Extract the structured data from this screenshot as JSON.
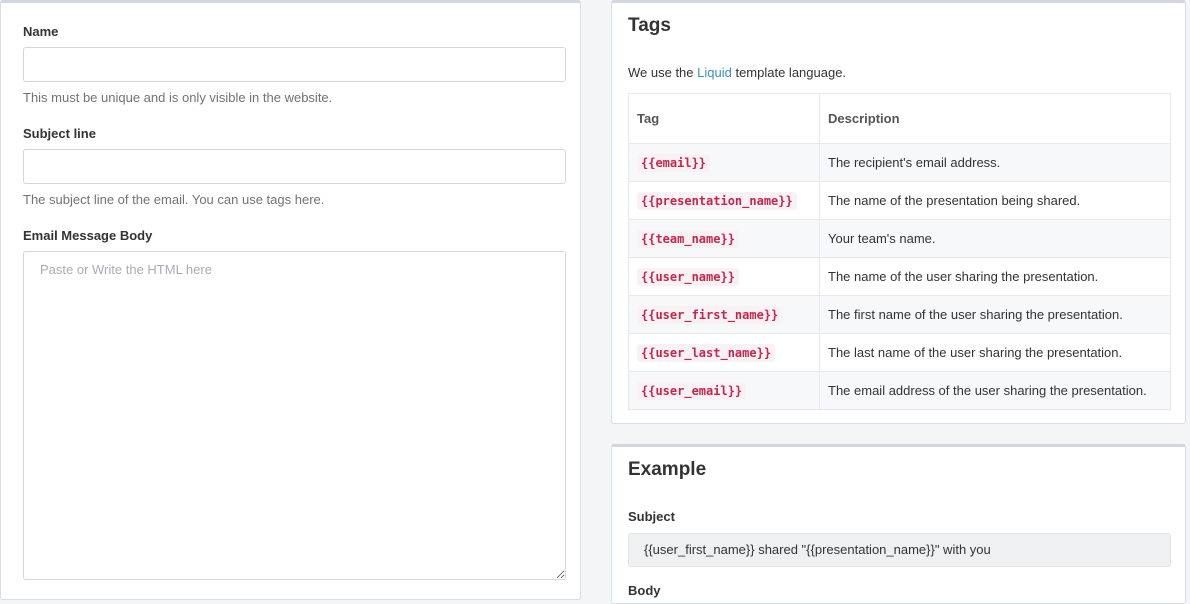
{
  "form": {
    "name_label": "Name",
    "name_value": "",
    "name_help": "This must be unique and is only visible in the website.",
    "subject_label": "Subject line",
    "subject_value": "",
    "subject_help": "The subject line of the email. You can use tags here.",
    "body_label": "Email Message Body",
    "body_placeholder": "Paste or Write the HTML here",
    "body_value": ""
  },
  "tags_panel": {
    "title": "Tags",
    "intro_prefix": "We use the ",
    "intro_link": "Liquid",
    "intro_suffix": " template language.",
    "columns": [
      "Tag",
      "Description"
    ],
    "rows": [
      {
        "tag": "{{email}}",
        "description": "The recipient's email address."
      },
      {
        "tag": "{{presentation_name}}",
        "description": "The name of the presentation being shared."
      },
      {
        "tag": "{{team_name}}",
        "description": "Your team's name."
      },
      {
        "tag": "{{user_name}}",
        "description": "The name of the user sharing the presentation."
      },
      {
        "tag": "{{user_first_name}}",
        "description": "The first name of the user sharing the presentation."
      },
      {
        "tag": "{{user_last_name}}",
        "description": "The last name of the user sharing the presentation."
      },
      {
        "tag": "{{user_email}}",
        "description": "The email address of the user sharing the presentation."
      }
    ]
  },
  "example_panel": {
    "title": "Example",
    "subject_label": "Subject",
    "subject_example": "{{user_first_name}} shared \"{{presentation_name}}\" with you",
    "body_label": "Body"
  },
  "colors": {
    "link": "#3c8dbc",
    "tag_text": "#c7254e",
    "tag_bg": "#f9f2f4"
  }
}
